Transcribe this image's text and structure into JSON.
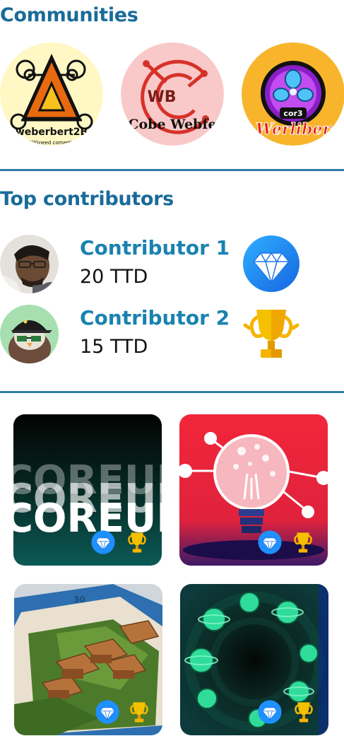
{
  "communities": {
    "title": "Communities",
    "items": [
      {
        "name": "weberbert2B",
        "tagline": "wi'llGneed comertion",
        "bg": "#fff8c4"
      },
      {
        "name": "Cobe Webfe",
        "monogram": "WB",
        "bg": "#f9c9c9"
      },
      {
        "name": "Werliber",
        "badge_text": "cor3",
        "bg": "#f8b52c"
      }
    ]
  },
  "contributors": {
    "title": "Top contributors",
    "items": [
      {
        "name": "Contributor 1",
        "amount": "20 TTD",
        "badge": "diamond-icon"
      },
      {
        "name": "Contributor 2",
        "amount": "15 TTD",
        "badge": "trophy-icon"
      }
    ]
  },
  "gallery": {
    "cards": [
      {
        "art_text": "COREUI",
        "style": "dark-typography"
      },
      {
        "style": "lightbulb-network"
      },
      {
        "style": "isometric-village"
      },
      {
        "style": "planet-ring"
      }
    ],
    "card_badges": [
      "diamond-icon",
      "trophy-icon"
    ]
  },
  "colors": {
    "heading": "#1a6b99",
    "contributor_name": "#1a82b0",
    "divider": "#2e7ea6",
    "diamond": "#1e90ff",
    "trophy": "#f5b400"
  }
}
